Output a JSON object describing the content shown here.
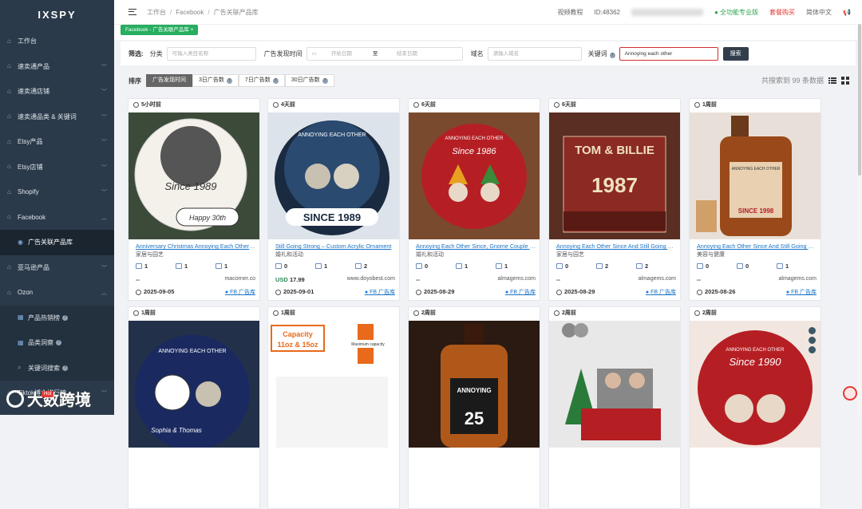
{
  "brand": "IXSPY",
  "sidebar": {
    "items": [
      {
        "label": "工作台",
        "icon": "home-icon"
      },
      {
        "label": "速卖通产品",
        "icon": "home-icon"
      },
      {
        "label": "速卖通店铺",
        "icon": "home-icon"
      },
      {
        "label": "速卖通品类 & 关键词",
        "icon": "home-icon"
      },
      {
        "label": "Etsy产品",
        "icon": "home-icon"
      },
      {
        "label": "Etsy店铺",
        "icon": "home-icon"
      },
      {
        "label": "Shopify",
        "icon": "home-icon"
      },
      {
        "label": "Facebook",
        "icon": "home-icon"
      },
      {
        "label": "广告关联产品库",
        "icon": "target-icon"
      },
      {
        "label": "亚马逊产品",
        "icon": "home-icon"
      },
      {
        "label": "Ozon",
        "icon": "home-icon"
      },
      {
        "label": "产品热销榜",
        "icon": "chart-icon"
      },
      {
        "label": "品类洞察",
        "icon": "chart-icon"
      },
      {
        "label": "关键词搜索",
        "icon": "search-icon"
      },
      {
        "label": "Tiktok博主排行榜",
        "icon": "home-icon"
      }
    ]
  },
  "topbar": {
    "breadcrumb": [
      "工作台",
      "Facebook",
      "广告关联产品库"
    ],
    "video_tutorial": "视频教程",
    "user_id": "ID:48362",
    "plan": "全功能专业版",
    "buy": "套餐购买",
    "language": "简体中文"
  },
  "tag": {
    "label": "Facebook - 广告关联产品库"
  },
  "filters": {
    "section_label": "筛选:",
    "category_label": "分类",
    "category_placeholder": "可输入类目名称",
    "ad_time_label": "广告发现时间",
    "start_placeholder": "开始日期",
    "to": "至",
    "end_placeholder": "结束日期",
    "domain_label": "域名",
    "domain_placeholder": "请输入域名",
    "keyword_label": "关键词",
    "keyword_value": "Annoying each other",
    "search_button": "搜索"
  },
  "sort": {
    "label": "排序",
    "options": [
      "广告发现时间",
      "3日广告数",
      "7日广告数",
      "30日广告数"
    ],
    "result_text": "共搜索到 99 条数据"
  },
  "cards": [
    {
      "ago": "5小时前",
      "title": "Anniversary Christmas Annoying Each Other Since 1989",
      "category": "家居与园艺",
      "stats": [
        "1",
        "1",
        "1"
      ],
      "price": "--",
      "currency": "",
      "site": "macorner.co",
      "date": "2025-09-05",
      "fb": "FB 广告库",
      "img_text1": "Since 1989",
      "img_text2": "Happy 30th"
    },
    {
      "ago": "4天前",
      "title": "Still Going Strong – Custom Acrylic Ornament",
      "category": "婚礼和活动",
      "stats": [
        "0",
        "1",
        "2"
      ],
      "price": "17.99",
      "currency": "USD",
      "site": "www.doyobest.com",
      "date": "2025-09-01",
      "fb": "FB 广告库",
      "img_text1": "SINCE 1989",
      "img_text2": "ANNOYING EACH OTHER"
    },
    {
      "ago": "6天前",
      "title": "Annoying Each Other Since, Gnome Couple Ornament",
      "category": "婚礼和活动",
      "stats": [
        "0",
        "1",
        "1"
      ],
      "price": "--",
      "currency": "",
      "site": "almagems.com",
      "date": "2025-08-29",
      "fb": "FB 广告库",
      "img_text1": "Since 1986",
      "img_text2": "ANNOYING EACH OTHER"
    },
    {
      "ago": "6天前",
      "title": "Annoying Each Other Since And Still Going Strong",
      "category": "家居与园艺",
      "stats": [
        "0",
        "2",
        "2"
      ],
      "price": "--",
      "currency": "",
      "site": "almagems.com",
      "date": "2025-08-29",
      "fb": "FB 广告库",
      "img_text1": "TOM & BILLIE",
      "img_text2": "1987"
    },
    {
      "ago": "1周前",
      "title": "Annoying Each Other Since And Still Going Strong",
      "category": "美容与健康",
      "stats": [
        "0",
        "0",
        "1"
      ],
      "price": "--",
      "currency": "",
      "site": "almagems.com",
      "date": "2025-08-26",
      "fb": "FB 广告库",
      "img_text1": "SINCE 1998",
      "img_text2": "ANNOYING EACH OTHER"
    },
    {
      "ago": "1周前",
      "img_text1": "Sophia & Thomas",
      "img_text2": "ANNOYING EACH OTHER"
    },
    {
      "ago": "1周前",
      "img_text1": "Capacity 11oz & 15oz",
      "img_text2": "Maximum capacity"
    },
    {
      "ago": "2周前",
      "img_text1": "ANNOYING EACH OTHER",
      "img_text2": "25"
    },
    {
      "ago": "2周前",
      "img_text1": "",
      "img_text2": ""
    },
    {
      "ago": "2周前",
      "img_text1": "Since 1990",
      "img_text2": "ANNOYING EACH OTHER"
    }
  ],
  "watermark": "大数跨境",
  "colors": {
    "sidebar_bg": "#2b3a4a",
    "accent_green": "#27ae60",
    "link_blue": "#1a73c5",
    "alert_red": "#e53935"
  }
}
